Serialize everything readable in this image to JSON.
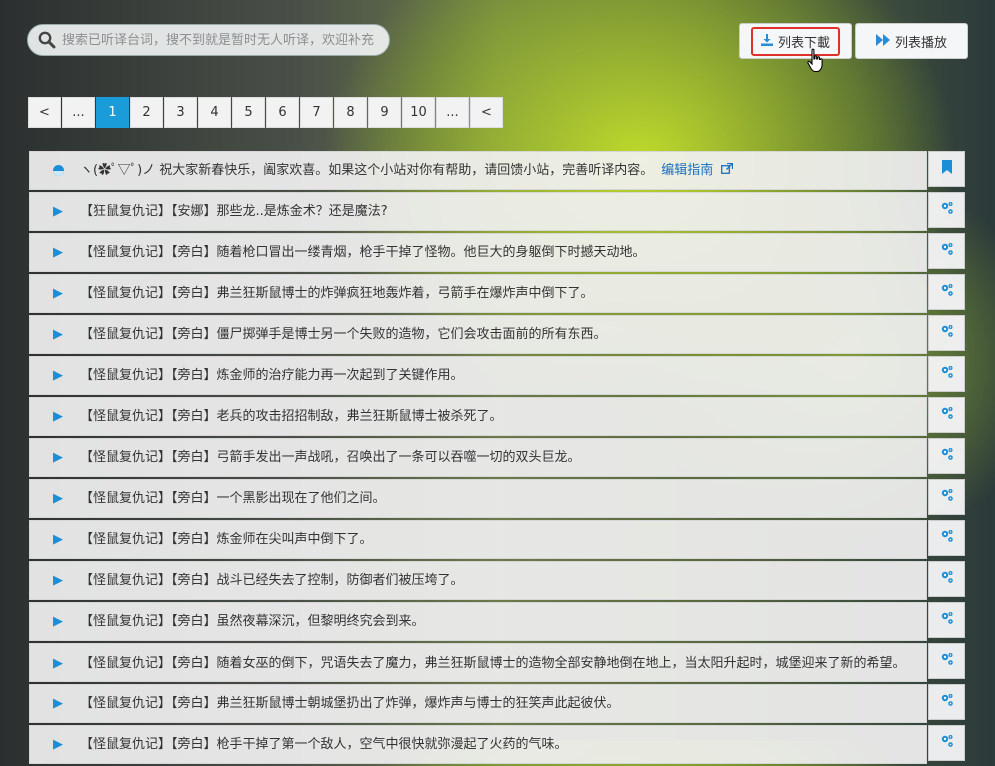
{
  "search": {
    "placeholder": "搜索已听译台词，搜不到就是暂时无人听译，欢迎补充",
    "icon": "search-icon"
  },
  "toolbar": {
    "download_label": "列表下載",
    "download_icon": "download-icon",
    "play_label": "列表播放",
    "play_icon": "fast-forward-icon"
  },
  "pagination": {
    "prev": "<",
    "ellipsis_left": "...",
    "pages": [
      "1",
      "2",
      "3",
      "4",
      "5",
      "6",
      "7",
      "8",
      "9",
      "10"
    ],
    "current": "1",
    "ellipsis_right": "...",
    "next": "<"
  },
  "notice": {
    "text": "ヽ(✿ﾟ▽ﾟ)ノ 祝大家新春快乐，阖家欢喜。如果这个小站对你有帮助，请回馈小站，完善听译内容。",
    "link": "编辑指南",
    "icon": "info-icon",
    "side_icon": "bookmark-icon"
  },
  "rows": [
    "【狂鼠复仇记】【安娜】那些龙..是炼金术？还是魔法?",
    "【怪鼠复仇记】【旁白】随着枪口冒出一缕青烟，枪手干掉了怪物。他巨大的身躯倒下时撼天动地。",
    "【怪鼠复仇记】【旁白】弗兰狂斯鼠博士的炸弹疯狂地轰炸着，弓箭手在爆炸声中倒下了。",
    "【怪鼠复仇记】【旁白】僵尸掷弹手是博士另一个失败的造物，它们会攻击面前的所有东西。",
    "【怪鼠复仇记】【旁白】炼金师的治疗能力再一次起到了关键作用。",
    "【怪鼠复仇记】【旁白】老兵的攻击招招制敌，弗兰狂斯鼠博士被杀死了。",
    "【怪鼠复仇记】【旁白】弓箭手发出一声战吼，召唤出了一条可以吞噬一切的双头巨龙。",
    "【怪鼠复仇记】【旁白】一个黑影出现在了他们之间。",
    "【怪鼠复仇记】【旁白】炼金师在尖叫声中倒下了。",
    "【怪鼠复仇记】【旁白】战斗已经失去了控制，防御者们被压垮了。",
    "【怪鼠复仇记】【旁白】虽然夜幕深沉，但黎明终究会到来。",
    "【怪鼠复仇记】【旁白】随着女巫的倒下，咒语失去了魔力，弗兰狂斯鼠博士的造物全部安静地倒在地上，当太阳升起时，城堡迎来了新的希望。",
    "【怪鼠复仇记】【旁白】弗兰狂斯鼠博士朝城堡扔出了炸弹，爆炸声与博士的狂笑声此起彼伏。",
    "【怪鼠复仇记】【旁白】枪手干掉了第一个敌人，空气中很快就弥漫起了火药的气味。"
  ],
  "row_play_icon": "play-icon",
  "row_side_icon": "cogs-icon",
  "colors": {
    "accent": "#1a9cd8",
    "highlight_border": "#e0302a"
  }
}
